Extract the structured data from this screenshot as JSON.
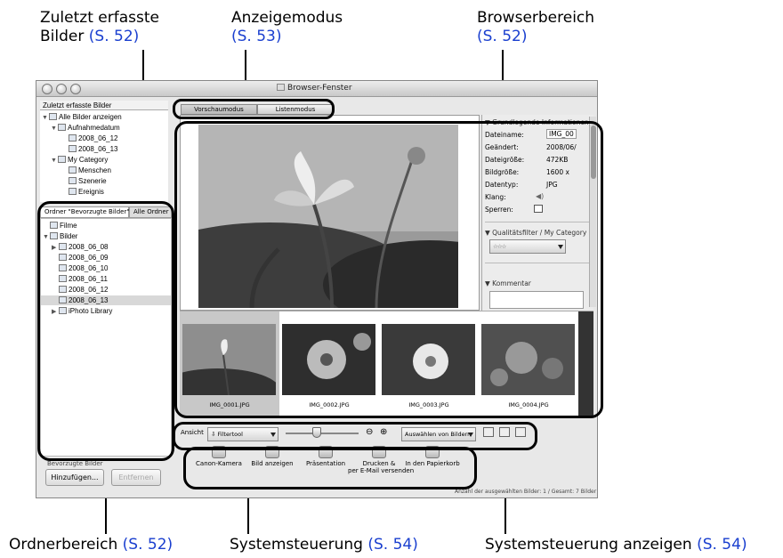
{
  "callouts": {
    "recent": {
      "l1": "Zuletzt erfasste",
      "l2": "Bilder",
      "ref": "(S. 52)"
    },
    "mode": {
      "l1": "Anzeigemodus",
      "ref": "(S. 53)"
    },
    "browser": {
      "l1": "Browserbereich",
      "ref": "(S. 52)"
    },
    "folder": {
      "l1": "Ordnerbereich",
      "ref": "(S. 52)"
    },
    "tasks": {
      "l1": "Systemsteuerung",
      "ref": "(S. 54)"
    },
    "view": {
      "l1": "Systemsteuerung anzeigen",
      "ref": "(S. 54)"
    }
  },
  "window": {
    "title": "Browser-Fenster"
  },
  "recent": {
    "header": "Zuletzt erfasste Bilder",
    "items": [
      "Alle Bilder anzeigen",
      "Aufnahmedatum",
      "2008_06_12",
      "2008_06_13",
      "My Category",
      "Menschen",
      "Szenerie",
      "Ereignis"
    ]
  },
  "folder_tabs": {
    "fav": "Ordner \"Bevorzugte Bilder\"",
    "all": "Alle Ordner"
  },
  "folders": [
    "Filme",
    "Bilder",
    "2008_06_08",
    "2008_06_09",
    "2008_06_10",
    "2008_06_11",
    "2008_06_12",
    "2008_06_13",
    "iPhoto Library"
  ],
  "favorites": {
    "label": "Bevorzugte Bilder",
    "add": "Hinzufügen...",
    "remove": "Entfernen"
  },
  "mode_tabs": {
    "preview": "Vorschaumodus",
    "list": "Listenmodus"
  },
  "info": {
    "header": "Grundlegende Informationen",
    "rows": [
      {
        "k": "Dateiname:",
        "v": "IMG_00"
      },
      {
        "k": "Geändert:",
        "v": "2008/06/"
      },
      {
        "k": "Dateigröße:",
        "v": "472KB"
      },
      {
        "k": "Bildgröße:",
        "v": "1600 x"
      },
      {
        "k": "Datentyp:",
        "v": "JPG"
      },
      {
        "k": "Klang:",
        "v": ""
      },
      {
        "k": "Sperren:",
        "v": ""
      }
    ],
    "quality": "Qualitätsfilter / My Category",
    "comment": "Kommentar"
  },
  "thumbs": [
    "IMG_0001.JPG",
    "IMG_0002.JPG",
    "IMG_0003.JPG",
    "IMG_0004.JPG"
  ],
  "controls": {
    "view": "Ansicht",
    "filter": "Filtertool",
    "select": "Auswählen von Bildern"
  },
  "tasks": [
    {
      "l1": "Canon-Kamera",
      "l2": ""
    },
    {
      "l1": "Bild anzeigen",
      "l2": ""
    },
    {
      "l1": "Präsentation",
      "l2": ""
    },
    {
      "l1": "Drucken &",
      "l2": "per E-Mail versenden"
    },
    {
      "l1": "In den Papierkorb",
      "l2": ""
    }
  ],
  "status": "Anzahl der ausgewählten Bilder: 1 / Gesamt: 7 Bilder",
  "colors": {
    "link": "#1a3fcf",
    "highlight": "#000000"
  }
}
